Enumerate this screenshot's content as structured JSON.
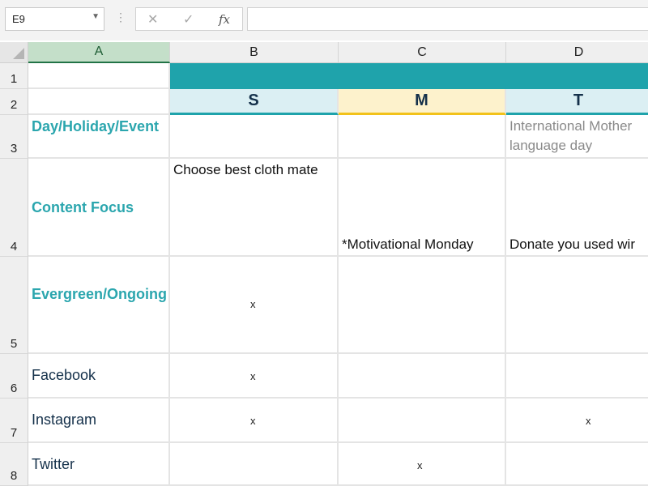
{
  "formula_bar": {
    "name_box": "E9",
    "cancel_icon": "✕",
    "enter_icon": "✓",
    "function_label": "fx",
    "formula": ""
  },
  "columns": [
    "A",
    "B",
    "C",
    "D"
  ],
  "rows": [
    "1",
    "2",
    "3",
    "4",
    "5",
    "6",
    "7",
    "8"
  ],
  "day_headers": {
    "B": "S",
    "C": "M",
    "D": "T"
  },
  "row_labels": {
    "r3": "Day/Holiday/Event",
    "r4": "Content Focus",
    "r5": "Evergreen/Ongoing",
    "r6": "Facebook",
    "r7": "Instagram",
    "r8": "Twitter"
  },
  "cells": {
    "D3": "International Mother language day",
    "B4": "Choose best cloth mate",
    "C4": "*Motivational Monday",
    "D4": "Donate you used wir",
    "B5": "x",
    "B6": "x",
    "B7": "x",
    "D7": "x",
    "C8": "x"
  },
  "colors": {
    "teal_band": "#1fa3ab",
    "sunday_fill": "#dbeff3",
    "monday_fill": "#fdf2cc",
    "monday_underline": "#f2c21b",
    "teal_underline": "#1fa3ab",
    "label_teal": "#2ba6ae"
  }
}
